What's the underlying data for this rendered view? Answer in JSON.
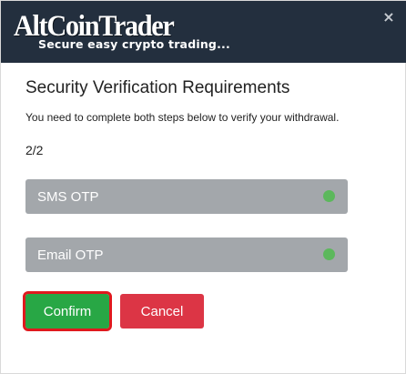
{
  "header": {
    "logo_title": "AltCoinTrader",
    "logo_tagline": "Secure easy crypto trading...",
    "close_symbol": "×",
    "background_color": "#232f3e"
  },
  "content": {
    "title": "Security Verification Requirements",
    "subtitle": "You need to complete both steps below to verify your withdrawal.",
    "step_counter": "2/2"
  },
  "otp_steps": [
    {
      "label": "SMS OTP",
      "status": "complete",
      "status_icon": "green-dot-icon"
    },
    {
      "label": "Email OTP",
      "status": "complete",
      "status_icon": "green-dot-icon"
    }
  ],
  "actions": {
    "confirm_label": "Confirm",
    "cancel_label": "Cancel",
    "confirm_color": "#28a745",
    "cancel_color": "#dc3545",
    "highlight_color": "#e0191e"
  }
}
